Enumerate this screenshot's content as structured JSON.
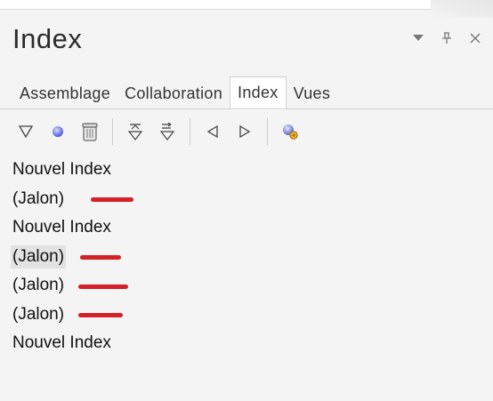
{
  "panel": {
    "title": "Index"
  },
  "tabs": [
    {
      "label": "Assemblage",
      "active": false
    },
    {
      "label": "Collaboration",
      "active": false
    },
    {
      "label": "Index",
      "active": true
    },
    {
      "label": "Vues",
      "active": false
    }
  ],
  "toolbar": {
    "buttons": [
      "filter-icon",
      "point-icon",
      "delete-icon",
      "sort-up-icon",
      "sort-down-icon",
      "previous-icon",
      "next-icon",
      "settings-icon"
    ]
  },
  "items": [
    {
      "label": "Nouvel Index",
      "mark": false
    },
    {
      "label": "(Jalon)",
      "mark": true
    },
    {
      "label": "Nouvel Index",
      "mark": false
    },
    {
      "label": "(Jalon)",
      "mark": true,
      "selected": true
    },
    {
      "label": "(Jalon)",
      "mark": true
    },
    {
      "label": "(Jalon)",
      "mark": true
    },
    {
      "label": "Nouvel Index",
      "mark": false
    }
  ],
  "colors": {
    "accent_mark": "#d52028",
    "panel_bg": "#f4f4f4"
  }
}
